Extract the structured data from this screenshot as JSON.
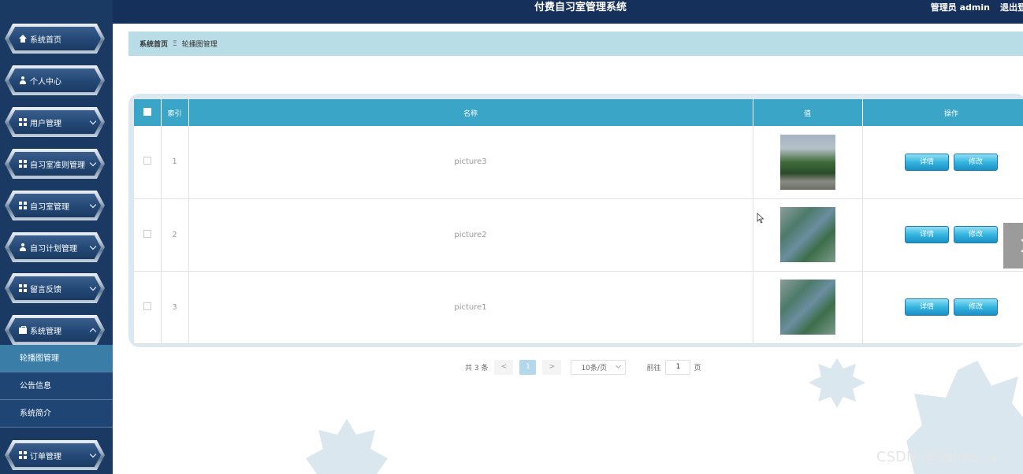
{
  "header": {
    "title": "付费自习室管理系统",
    "admin_text": "管理员 admin",
    "logout_label": "退出登"
  },
  "sidebar": {
    "items": [
      {
        "label": "系统首页",
        "icon": "home-icon"
      },
      {
        "label": "个人中心",
        "icon": "user-icon"
      },
      {
        "label": "用户管理",
        "icon": "grid-icon"
      },
      {
        "label": "自习室准则管理",
        "icon": "grid-icon"
      },
      {
        "label": "自习室管理",
        "icon": "grid-icon"
      },
      {
        "label": "自习计划管理",
        "icon": "user-icon"
      },
      {
        "label": "留言反馈",
        "icon": "grid-icon"
      },
      {
        "label": "系统管理",
        "icon": "briefcase-icon"
      },
      {
        "label": "订单管理",
        "icon": "grid-icon"
      }
    ],
    "sub_items": [
      {
        "label": "轮播图管理",
        "active": true
      },
      {
        "label": "公告信息",
        "active": false
      },
      {
        "label": "系统简介",
        "active": false
      }
    ]
  },
  "breadcrumb": {
    "home": "系统首页",
    "separator": "Ξ",
    "current": "轮播图管理"
  },
  "table": {
    "headers": {
      "index": "索引",
      "name": "名称",
      "value": "值",
      "actions": "操作"
    },
    "rows": [
      {
        "index": "1",
        "name": "picture3",
        "image": "campus-gate-photo"
      },
      {
        "index": "2",
        "name": "picture2",
        "image": "aerial-building-photo"
      },
      {
        "index": "3",
        "name": "picture1",
        "image": "aerial-building-photo"
      }
    ],
    "detail_label": "详情",
    "edit_label": "修改"
  },
  "pagination": {
    "total": "共 3 条",
    "prev": "<",
    "current_page": "1",
    "next": ">",
    "page_size": "10条/页",
    "goto_label": "前往",
    "goto_value": "1",
    "goto_suffix": "页"
  },
  "watermark": "CSDN @Selina .a",
  "colors": {
    "sidebar_bg": "#1b3a63",
    "header_bg": "#15305a",
    "table_header": "#3aa5c6",
    "breadcrumb_bg": "#b9dde6",
    "active_sub": "#3a7ea8"
  }
}
